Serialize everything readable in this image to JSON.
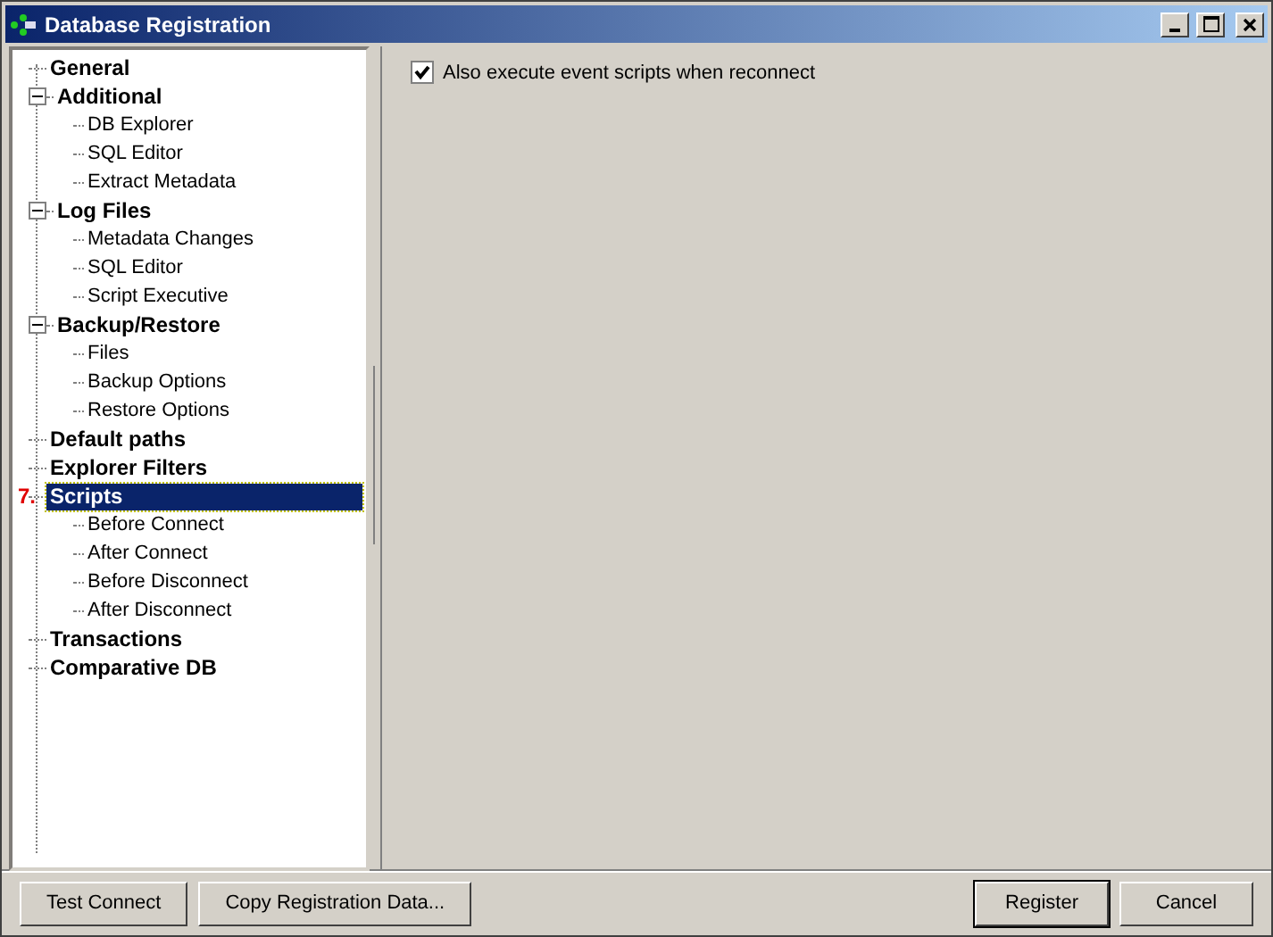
{
  "window": {
    "title": "Database Registration"
  },
  "tree": [
    {
      "label": "General",
      "selected": false
    },
    {
      "label": "Additional",
      "selected": false,
      "expanded": true,
      "children": [
        {
          "label": "DB Explorer",
          "selected": false
        },
        {
          "label": "SQL Editor",
          "selected": false
        },
        {
          "label": "Extract Metadata",
          "selected": false
        }
      ]
    },
    {
      "label": "Log Files",
      "selected": false,
      "expanded": true,
      "children": [
        {
          "label": "Metadata Changes",
          "selected": false
        },
        {
          "label": "SQL Editor",
          "selected": false
        },
        {
          "label": "Script Executive",
          "selected": false
        }
      ]
    },
    {
      "label": "Backup/Restore",
      "selected": false,
      "expanded": true,
      "children": [
        {
          "label": "Files",
          "selected": false
        },
        {
          "label": "Backup Options",
          "selected": false
        },
        {
          "label": "Restore Options",
          "selected": false
        }
      ]
    },
    {
      "label": "Default paths",
      "selected": false
    },
    {
      "label": "Explorer Filters",
      "selected": false
    },
    {
      "label": "Scripts",
      "selected": true,
      "annotation": "7.",
      "children": [
        {
          "label": "Before Connect",
          "selected": false
        },
        {
          "label": "After Connect",
          "selected": false
        },
        {
          "label": "Before Disconnect",
          "selected": false
        },
        {
          "label": "After Disconnect",
          "selected": false
        }
      ]
    },
    {
      "label": "Transactions",
      "selected": false
    },
    {
      "label": "Comparative DB",
      "selected": false
    }
  ],
  "option": {
    "label": "Also execute event scripts when reconnect",
    "checked": true
  },
  "left_buttons": [
    "Test Connect",
    "Copy Registration Data..."
  ],
  "right_buttons": [
    {
      "label": "Register",
      "default": true
    },
    {
      "label": "Cancel",
      "default": false
    }
  ]
}
